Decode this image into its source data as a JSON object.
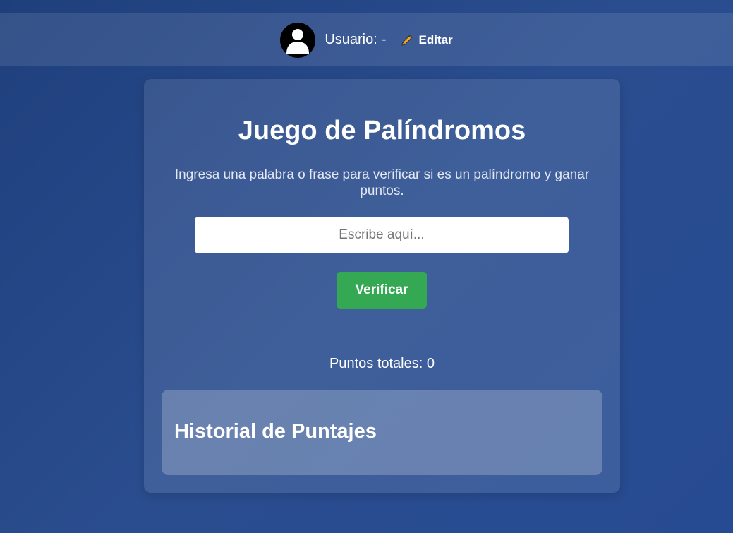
{
  "header": {
    "user_label": "Usuario:",
    "user_value": "-",
    "edit_label": "Editar"
  },
  "game": {
    "title": "Juego de Palíndromos",
    "subtitle": "Ingresa una palabra o frase para verificar si es un palíndromo y ganar puntos.",
    "input_value": "",
    "input_placeholder": "Escribe aquí...",
    "verify_label": "Verificar",
    "points_label": "Puntos totales:",
    "points_value": "0"
  },
  "history": {
    "title": "Historial de Puntajes"
  },
  "colors": {
    "background": "#264887",
    "verify_button": "#34a853",
    "avatar": "#000000",
    "pencil": "#f5a623"
  },
  "icons": {
    "avatar": "user-avatar-icon",
    "edit": "pencil-icon"
  }
}
